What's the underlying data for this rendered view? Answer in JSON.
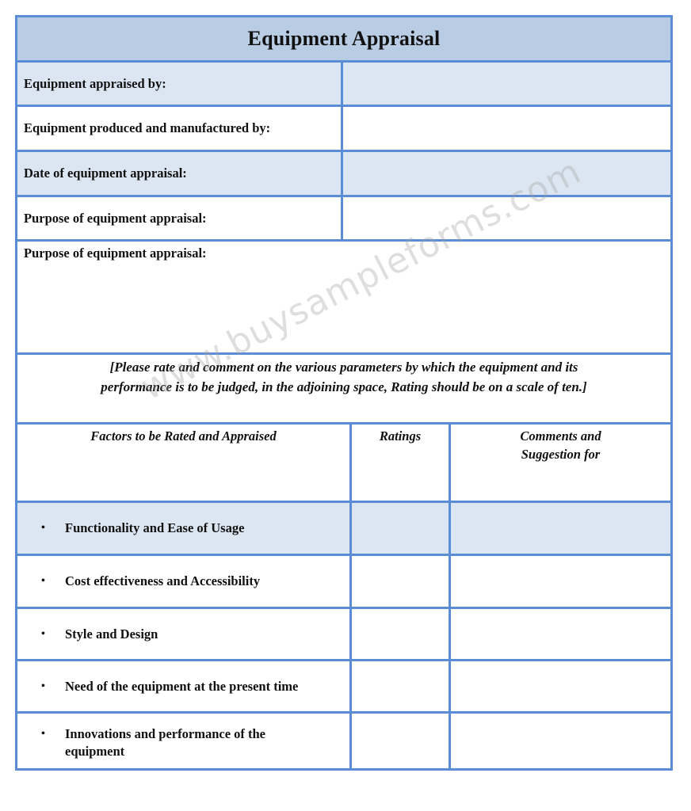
{
  "form": {
    "title": "Equipment Appraisal",
    "fields": [
      {
        "label": "Equipment appraised by:",
        "value": ""
      },
      {
        "label": "Equipment produced and manufactured by:",
        "value": ""
      },
      {
        "label": "Date of equipment appraisal:",
        "value": ""
      },
      {
        "label": "Purpose of equipment appraisal:",
        "value": ""
      }
    ],
    "purpose_box": {
      "label": "Purpose of equipment appraisal:",
      "value": ""
    },
    "instructions": {
      "line1": "[Please rate and comment on the various parameters by which the equipment and its",
      "line2": "performance is to be judged, in the adjoining space, Rating should be on a scale of ten.]"
    },
    "table": {
      "headers": {
        "factors": "Factors to be Rated and Appraised",
        "ratings": "Ratings",
        "comments_line1": "Comments and",
        "comments_line2": "Suggestion for"
      },
      "bullet_glyph": "•",
      "rows": [
        {
          "factor": "Functionality and Ease of Usage",
          "rating": "",
          "comment": ""
        },
        {
          "factor": "Cost effectiveness and Accessibility",
          "rating": "",
          "comment": ""
        },
        {
          "factor": "Style and Design",
          "rating": "",
          "comment": ""
        },
        {
          "factor": "Need of the equipment at the present time",
          "rating": "",
          "comment": ""
        },
        {
          "factor": "Innovations and performance of the equipment",
          "rating": "",
          "comment": ""
        }
      ]
    }
  },
  "watermark": "www.buysampleforms.com",
  "colors": {
    "border": "#5b8dd6",
    "title_fill": "#b8cce4",
    "shaded_row": "#dce6f2"
  }
}
